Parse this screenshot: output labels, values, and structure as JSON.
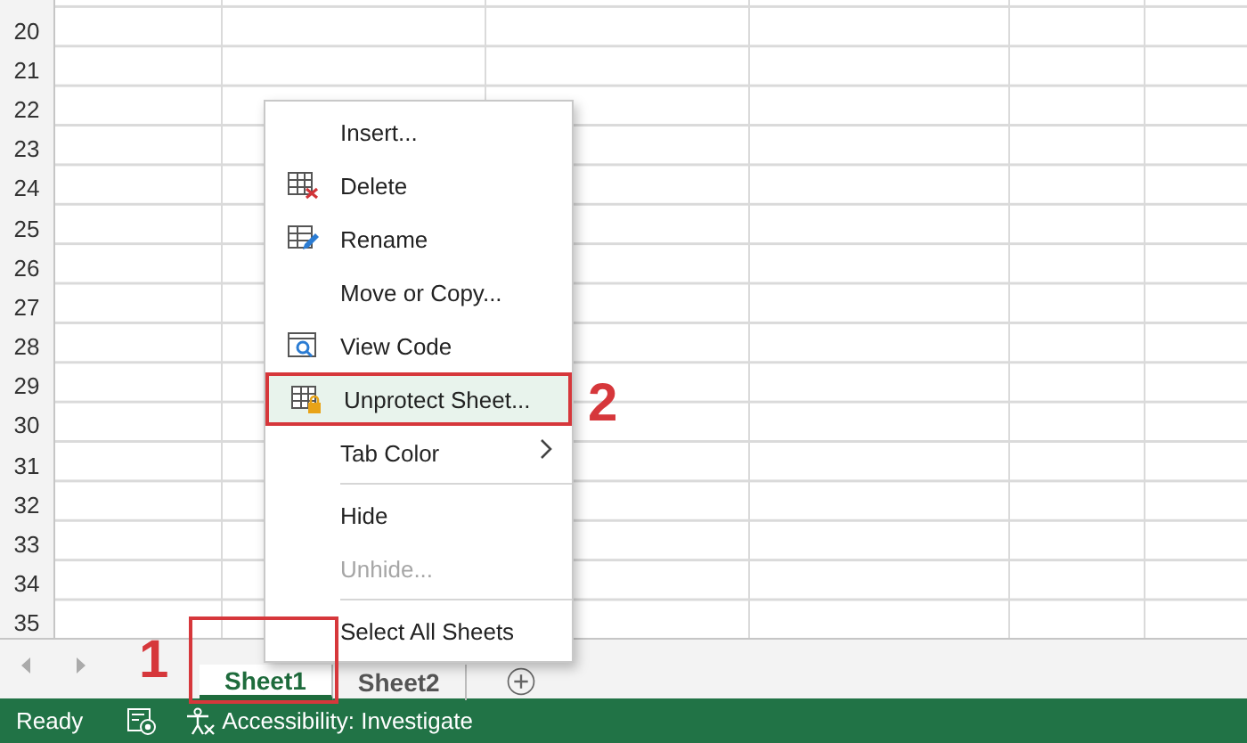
{
  "sheet": {
    "row_numbers": [
      "20",
      "21",
      "22",
      "23",
      "24",
      "25",
      "26",
      "27",
      "28",
      "29",
      "30",
      "31",
      "32",
      "33",
      "34",
      "35"
    ]
  },
  "context_menu": {
    "items": [
      {
        "kind": "item",
        "label": "Insert...",
        "disabled": false,
        "selected": false
      },
      {
        "kind": "item",
        "label": "Delete",
        "disabled": false,
        "selected": false
      },
      {
        "kind": "item",
        "label": "Rename",
        "disabled": false,
        "selected": false
      },
      {
        "kind": "item",
        "label": "Move or Copy...",
        "disabled": false,
        "selected": false
      },
      {
        "kind": "item",
        "label": "View Code",
        "disabled": false,
        "selected": false
      },
      {
        "kind": "item",
        "label": "Unprotect Sheet...",
        "disabled": false,
        "selected": true
      },
      {
        "kind": "submenu",
        "label": "Tab Color",
        "disabled": false,
        "selected": false
      },
      {
        "kind": "separator"
      },
      {
        "kind": "item",
        "label": "Hide",
        "disabled": false,
        "selected": false
      },
      {
        "kind": "item",
        "label": "Unhide...",
        "disabled": true,
        "selected": false
      },
      {
        "kind": "separator"
      },
      {
        "kind": "item",
        "label": "Select All Sheets",
        "disabled": false,
        "selected": false
      }
    ]
  },
  "sheet_tabs": [
    {
      "label": "Sheet1",
      "selected": true
    },
    {
      "label": "Sheet2",
      "selected": false
    }
  ],
  "annotations": [
    {
      "label": "1"
    },
    {
      "label": "2"
    }
  ],
  "status_bar": {
    "status": "Ready",
    "accessibility": "Accessibility: Investigate"
  }
}
